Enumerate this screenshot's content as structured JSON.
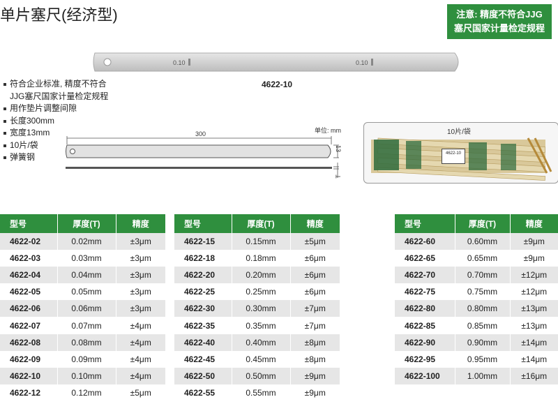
{
  "title": "单片塞尺(经济型)",
  "notice": {
    "line1": "注意: 精度不符合JJG",
    "line2": "塞尺国家计量检定规程"
  },
  "blade_marking": "0.10",
  "model_label": "4622-10",
  "features": [
    "符合企业标准, 精度不符合",
    "JJG塞尺国家计量检定规程",
    "用作垫片调整间隙",
    "长度300mm",
    "宽度13mm",
    "10片/袋",
    "弹簧钢"
  ],
  "drawing": {
    "unit": "单位: mm",
    "length": "300",
    "width": "13",
    "thickness": "T"
  },
  "photo": {
    "label": "10片/袋",
    "pack_text": "4622-10"
  },
  "table_headers": [
    "型号",
    "厚度(T)",
    "精度"
  ],
  "tables": [
    [
      [
        "4622-02",
        "0.02mm",
        "±3μm"
      ],
      [
        "4622-03",
        "0.03mm",
        "±3μm"
      ],
      [
        "4622-04",
        "0.04mm",
        "±3μm"
      ],
      [
        "4622-05",
        "0.05mm",
        "±3μm"
      ],
      [
        "4622-06",
        "0.06mm",
        "±3μm"
      ],
      [
        "4622-07",
        "0.07mm",
        "±4μm"
      ],
      [
        "4622-08",
        "0.08mm",
        "±4μm"
      ],
      [
        "4622-09",
        "0.09mm",
        "±4μm"
      ],
      [
        "4622-10",
        "0.10mm",
        "±4μm"
      ],
      [
        "4622-12",
        "0.12mm",
        "±5μm"
      ]
    ],
    [
      [
        "4622-15",
        "0.15mm",
        "±5μm"
      ],
      [
        "4622-18",
        "0.18mm",
        "±6μm"
      ],
      [
        "4622-20",
        "0.20mm",
        "±6μm"
      ],
      [
        "4622-25",
        "0.25mm",
        "±6μm"
      ],
      [
        "4622-30",
        "0.30mm",
        "±7μm"
      ],
      [
        "4622-35",
        "0.35mm",
        "±7μm"
      ],
      [
        "4622-40",
        "0.40mm",
        "±8μm"
      ],
      [
        "4622-45",
        "0.45mm",
        "±8μm"
      ],
      [
        "4622-50",
        "0.50mm",
        "±9μm"
      ],
      [
        "4622-55",
        "0.55mm",
        "±9μm"
      ]
    ],
    [
      [
        "4622-60",
        "0.60mm",
        "±9μm"
      ],
      [
        "4622-65",
        "0.65mm",
        "±9μm"
      ],
      [
        "4622-70",
        "0.70mm",
        "±12μm"
      ],
      [
        "4622-75",
        "0.75mm",
        "±12μm"
      ],
      [
        "4622-80",
        "0.80mm",
        "±13μm"
      ],
      [
        "4622-85",
        "0.85mm",
        "±13μm"
      ],
      [
        "4622-90",
        "0.90mm",
        "±14μm"
      ],
      [
        "4622-95",
        "0.95mm",
        "±14μm"
      ],
      [
        "4622-100",
        "1.00mm",
        "±16μm"
      ]
    ]
  ],
  "colors": {
    "accent_green": "#2f8f3e",
    "row_stripe": "#e6e6e6"
  }
}
